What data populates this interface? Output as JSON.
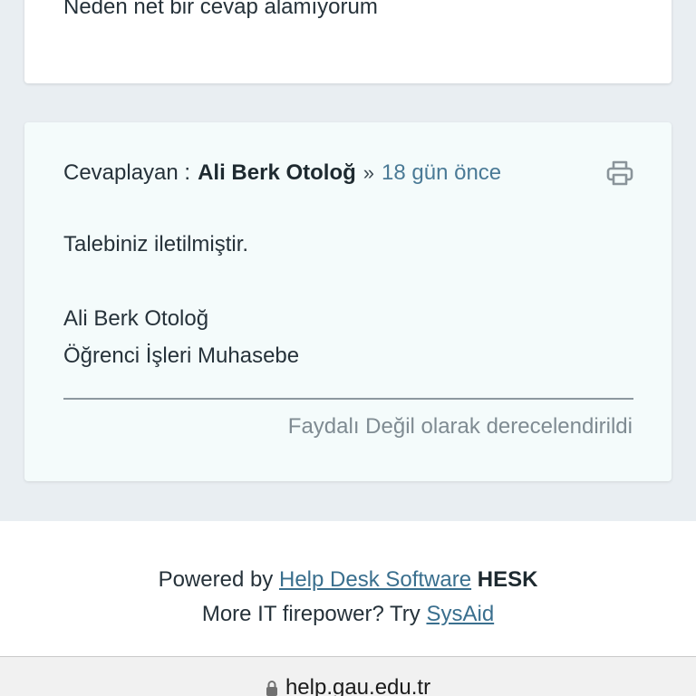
{
  "previous_message": {
    "text": "Neden net bir cevap alamıyorum"
  },
  "reply": {
    "label": "Cevaplayan :",
    "author": "Ali Berk Otoloğ",
    "separator": "»",
    "time_ago": "18 gün önce",
    "print_icon": "printer-icon",
    "body_line_1": "Talebiniz iletilmiştir.",
    "signature_name": "Ali Berk Otoloğ",
    "signature_dept": "Öğrenci İşleri Muhasebe",
    "rating_text": "Faydalı Değil olarak derecelendirildi"
  },
  "footer": {
    "powered_prefix": "Powered by",
    "powered_link": "Help Desk Software",
    "powered_brand": "HESK",
    "more_prefix": "More IT firepower? Try",
    "more_link": "SysAid"
  },
  "browser": {
    "lock_icon": "lock-icon",
    "url": "help.gau.edu.tr"
  },
  "colors": {
    "page_bg": "#e9eef2",
    "reply_card_bg": "#f4fbfb",
    "link": "#3a6f8e",
    "time": "#4a7a96"
  }
}
